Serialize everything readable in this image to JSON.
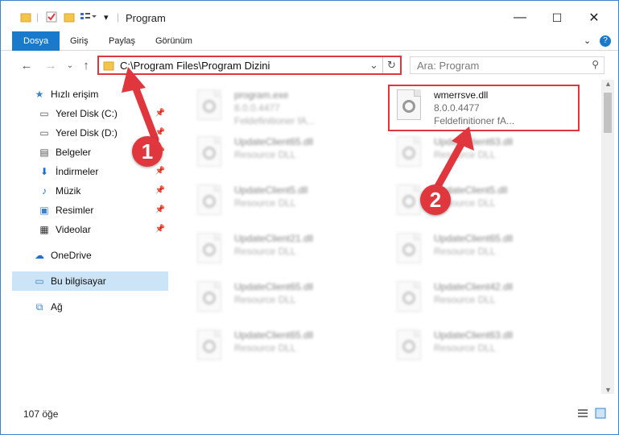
{
  "window": {
    "title": "Program",
    "controls": {
      "minimize": "—",
      "maximize": "☐",
      "close": "✕"
    }
  },
  "ribbon": {
    "tabs": [
      "Dosya",
      "Giriş",
      "Paylaş",
      "Görünüm"
    ],
    "chevron": "⌄",
    "help": "?"
  },
  "nav": {
    "address": "C:\\Program Files\\Program Dizini",
    "search_placeholder": "Ara: Program"
  },
  "sidebar": {
    "items": [
      {
        "label": "Hızlı erişim",
        "icon": "star-icon",
        "pinned": false
      },
      {
        "label": "Yerel Disk (C:)",
        "icon": "drive-icon",
        "pinned": true
      },
      {
        "label": "Yerel Disk (D:)",
        "icon": "drive-icon",
        "pinned": true
      },
      {
        "label": "Belgeler",
        "icon": "documents-icon",
        "pinned": true
      },
      {
        "label": "İndirmeler",
        "icon": "download-icon",
        "pinned": true
      },
      {
        "label": "Müzik",
        "icon": "music-icon",
        "pinned": true
      },
      {
        "label": "Resimler",
        "icon": "pictures-icon",
        "pinned": true
      },
      {
        "label": "Videolar",
        "icon": "videos-icon",
        "pinned": true
      },
      {
        "label": "OneDrive",
        "icon": "cloud-icon",
        "pinned": false
      },
      {
        "label": "Bu bilgisayar",
        "icon": "computer-icon",
        "pinned": false
      },
      {
        "label": "Ağ",
        "icon": "network-icon",
        "pinned": false
      }
    ]
  },
  "files": [
    {
      "name": "program.exe",
      "line2": "8.0.0.4477",
      "line3": "Feldefinitioner fA...",
      "blurred": true
    },
    {
      "name": "wmerrsve.dll",
      "line2": "8.0.0.4477",
      "line3": "Feldefinitioner fA...",
      "blurred": false
    },
    {
      "name": "UpdateClient65.dll",
      "line2": "Resource DLL",
      "blurred": true
    },
    {
      "name": "UpdateClient63.dll",
      "line2": "Resource DLL",
      "blurred": true
    },
    {
      "name": "UpdateClient5.dll",
      "line2": "Resource DLL",
      "blurred": true
    },
    {
      "name": "UpdateClient5.dll",
      "line2": "Resource DLL",
      "blurred": true
    },
    {
      "name": "UpdateClient21.dll",
      "line2": "Resource DLL",
      "blurred": true
    },
    {
      "name": "UpdateClient65.dll",
      "line2": "Resource DLL",
      "blurred": true
    },
    {
      "name": "UpdateClient65.dll",
      "line2": "Resource DLL",
      "blurred": true
    },
    {
      "name": "UpdateClient42.dll",
      "line2": "Resource DLL",
      "blurred": true
    },
    {
      "name": "UpdateClient65.dll",
      "line2": "Resource DLL",
      "blurred": true
    },
    {
      "name": "UpdateClient63.dll",
      "line2": "Resource DLL",
      "blurred": true
    }
  ],
  "status": {
    "count": "107 öğe"
  },
  "annotations": {
    "badge1": "1",
    "badge2": "2",
    "color": "#e0373f"
  }
}
